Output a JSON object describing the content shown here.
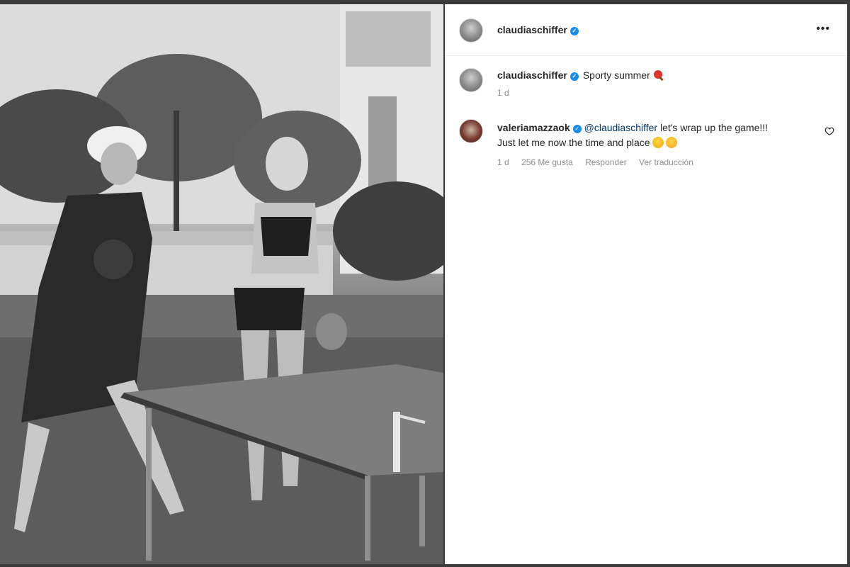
{
  "post": {
    "author": {
      "username": "claudiaschiffer",
      "verified": true
    },
    "more_icon": "more-horizontal-icon",
    "caption": {
      "username": "claudiaschiffer",
      "text": "Sporty summer",
      "emoji": "ping-pong-paddle",
      "age": "1 d"
    },
    "photo": {
      "description_icon": "photo"
    }
  },
  "comments": [
    {
      "username": "valeriamazzaok",
      "verified": true,
      "mention": "@claudiaschiffer",
      "text_line1": "let's wrap up the game!!!",
      "text_line2": "Just let me now the time and place",
      "emojis": [
        "laughing-face",
        "yum-face"
      ],
      "age": "1 d",
      "likes": "256 Me gusta",
      "reply_label": "Responder",
      "translate_label": "Ver traducción",
      "like_icon": "heart-icon"
    }
  ],
  "colors": {
    "verified": "#1a8cf0",
    "mention": "#00376b",
    "meta": "#8e8e8e",
    "text": "#262626"
  }
}
